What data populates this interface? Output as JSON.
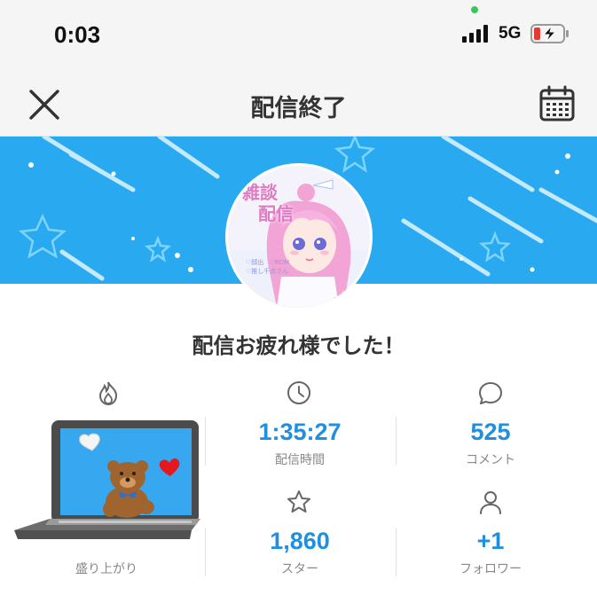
{
  "status_bar": {
    "time": "0:03",
    "network": "5G"
  },
  "header": {
    "title": "配信終了"
  },
  "greeting": "配信お疲れ様でした！",
  "avatar": {
    "text_lines": [
      "雑談",
      "配信"
    ],
    "tags": [
      "♡顔出",
      "♡ROM",
      "♡推し千点さん"
    ]
  },
  "stats": {
    "excitement": {
      "label": "盛り上がり"
    },
    "duration": {
      "value": "1:35:27",
      "label": "配信時間"
    },
    "comments": {
      "value": "525",
      "label": "コメント"
    },
    "stars": {
      "value": "1,860",
      "label": "スター"
    },
    "followers": {
      "value": "+1",
      "label": "フォロワー"
    }
  },
  "icons": {
    "close": "close-icon",
    "calendar": "calendar-icon",
    "flame": "flame-icon",
    "clock": "clock-icon",
    "comment": "comment-icon",
    "star": "star-icon",
    "person": "person-icon"
  },
  "colors": {
    "accent": "#1f8fe0",
    "banner": "#29aaf0",
    "battery_low": "#e53935"
  }
}
